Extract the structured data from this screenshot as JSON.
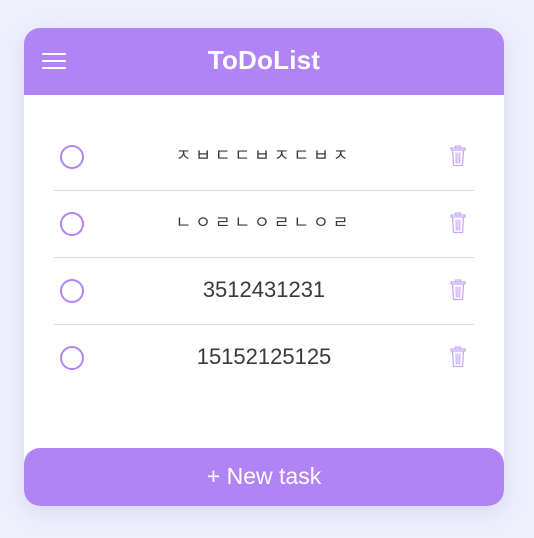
{
  "header": {
    "title": "ToDoList",
    "menu_icon": "hamburger-menu-icon"
  },
  "tasks": [
    {
      "text": "ㅈㅂㄷㄷㅂㅈㄷㅂㅈ",
      "completed": false
    },
    {
      "text": "ㄴㅇㄹㄴㅇㄹㄴㅇㄹ",
      "completed": false
    },
    {
      "text": "3512431231",
      "completed": false
    },
    {
      "text": "15152125125",
      "completed": false
    }
  ],
  "footer": {
    "new_task_label": "+ New task"
  },
  "colors": {
    "accent": "#b283f4",
    "background": "#eef1fc",
    "card": "#ffffff",
    "text": "#3a3a3a",
    "divider": "#dcdcdc"
  },
  "icons": {
    "check": "circle-checkbox-icon",
    "delete": "trash-icon"
  }
}
